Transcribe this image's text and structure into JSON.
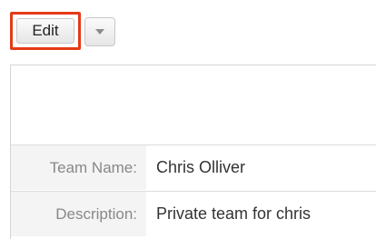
{
  "toolbar": {
    "edit_label": "Edit",
    "highlight_color": "#e53a17"
  },
  "icons": {
    "dropdown": "chevron-down-icon"
  },
  "record": {
    "fields": [
      {
        "label": "Team Name:",
        "value": "Chris Olliver"
      },
      {
        "label": "Description:",
        "value": "Private team for chris"
      }
    ]
  }
}
